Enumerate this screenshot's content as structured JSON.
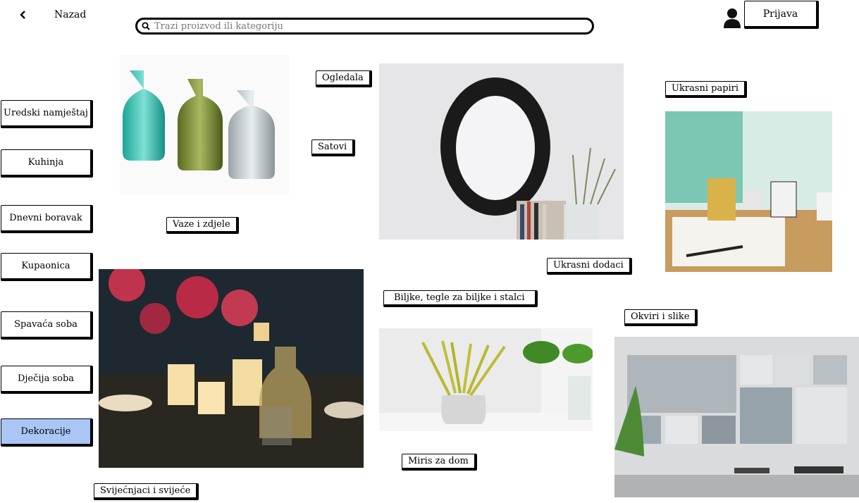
{
  "header": {
    "back_label": "Nazad",
    "search_placeholder": "Trazi proizvod ili kategoriju",
    "login_label": "Prijava"
  },
  "sidebar": {
    "items": [
      {
        "label": "Uredski namještaj",
        "active": false
      },
      {
        "label": "Kuhinja",
        "active": false
      },
      {
        "label": "Dnevni boravak",
        "active": false
      },
      {
        "label": "Kupaonica",
        "active": false
      },
      {
        "label": "Spavaća soba",
        "active": false
      },
      {
        "label": "Dječija soba",
        "active": false
      },
      {
        "label": "Dekoracije",
        "active": true
      }
    ]
  },
  "categories": {
    "ogledala": "Ogledala",
    "satovi": "Satovi",
    "vaze": "Vaze i zdjele",
    "ukrasni_papiri": "Ukrasni papiri",
    "ukrasni_dodaci": "Ukrasni dodaci",
    "biljke": "Biljke, tegle za biljke i stalci",
    "okviri": "Okviri i slike",
    "miris": "Miris za dom",
    "svijecnjaci": "Svijećnjaci i svijeće"
  },
  "colors": {
    "active_item": "#a9c6f5",
    "border": "#000000"
  }
}
